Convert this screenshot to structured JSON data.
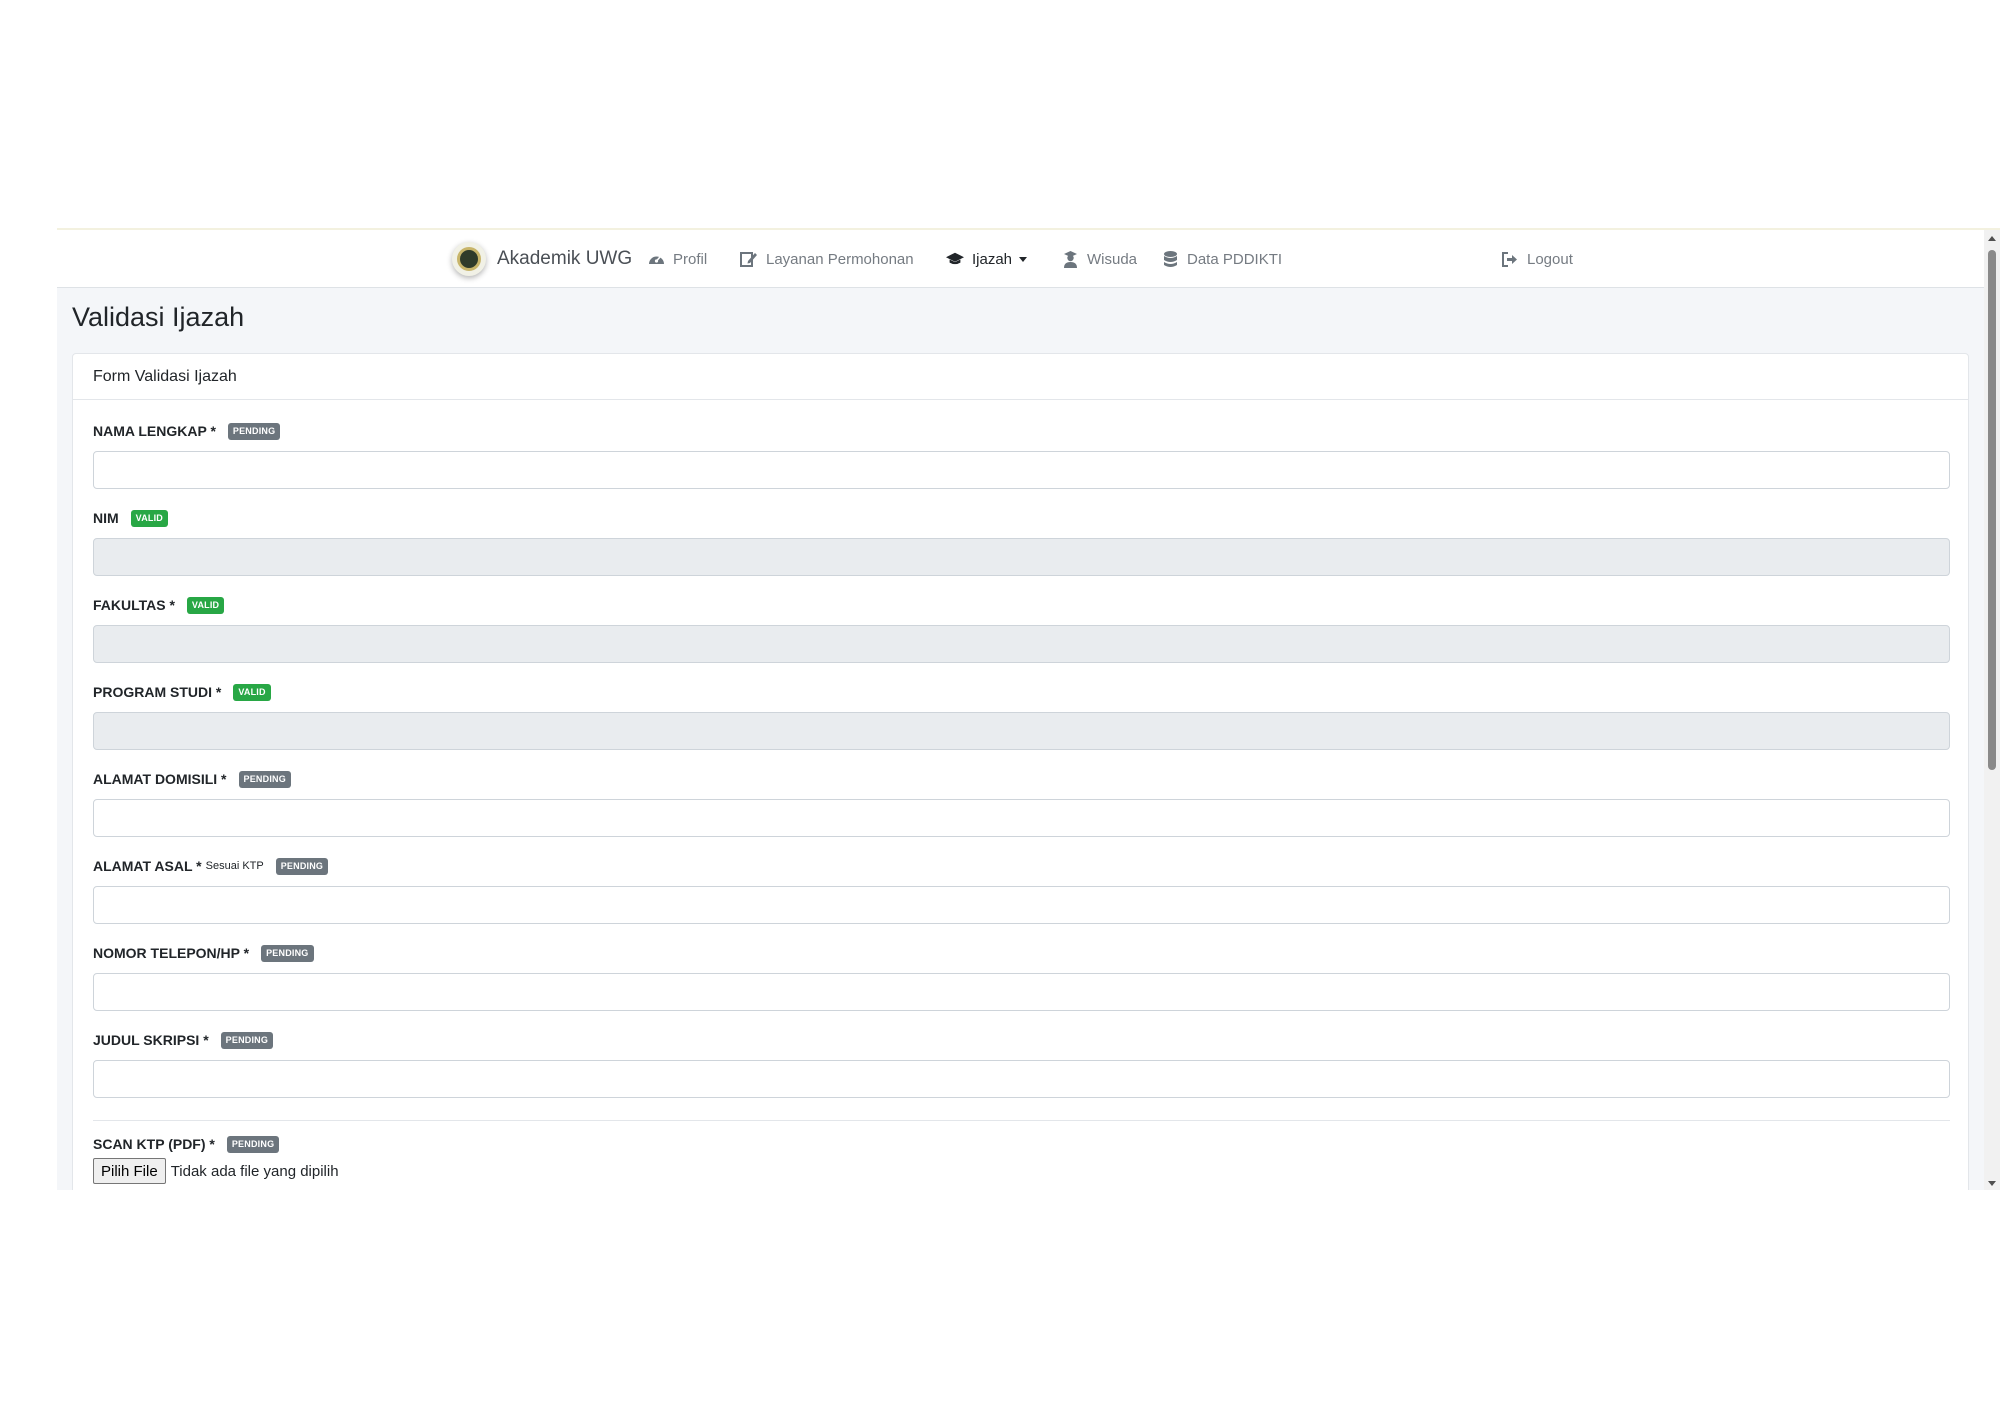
{
  "navbar": {
    "brand": "Akademik UWG",
    "items": [
      {
        "label": "Profil",
        "icon": "tachometer-icon"
      },
      {
        "label": "Layanan Permohonan",
        "icon": "edit-icon"
      },
      {
        "label": "Ijazah",
        "icon": "graduation-cap-icon"
      },
      {
        "label": "Wisuda",
        "icon": "user-graduate-icon"
      },
      {
        "label": "Data PDDIKTI",
        "icon": "database-icon"
      },
      {
        "label": "Logout",
        "icon": "sign-out-icon"
      }
    ]
  },
  "page": {
    "title": "Validasi Ijazah",
    "card_title": "Form Validasi Ijazah"
  },
  "form": {
    "fields": [
      {
        "label": "NAMA LENGKAP *",
        "status": "PENDING",
        "value": ""
      },
      {
        "label": "NIM",
        "status": "VALID",
        "value": ""
      },
      {
        "label": "FAKULTAS *",
        "status": "VALID",
        "value": ""
      },
      {
        "label": "PROGRAM STUDI *",
        "status": "VALID",
        "value": ""
      },
      {
        "label": "ALAMAT DOMISILI *",
        "status": "PENDING",
        "value": ""
      },
      {
        "label": "ALAMAT ASAL *",
        "note": "Sesuai KTP",
        "status": "PENDING",
        "value": ""
      },
      {
        "label": "NOMOR TELEPON/HP *",
        "status": "PENDING",
        "value": ""
      },
      {
        "label": "JUDUL SKRIPSI *",
        "status": "PENDING",
        "value": ""
      }
    ],
    "upload": {
      "label": "SCAN KTP (PDF) *",
      "status": "PENDING",
      "button": "Pilih File",
      "file_text": "Tidak ada file yang dipilih"
    }
  },
  "colors": {
    "valid": "#28a745",
    "pending": "#6c757d",
    "readonly_bg": "#e9ecef",
    "page_bg": "#f4f6f9"
  }
}
